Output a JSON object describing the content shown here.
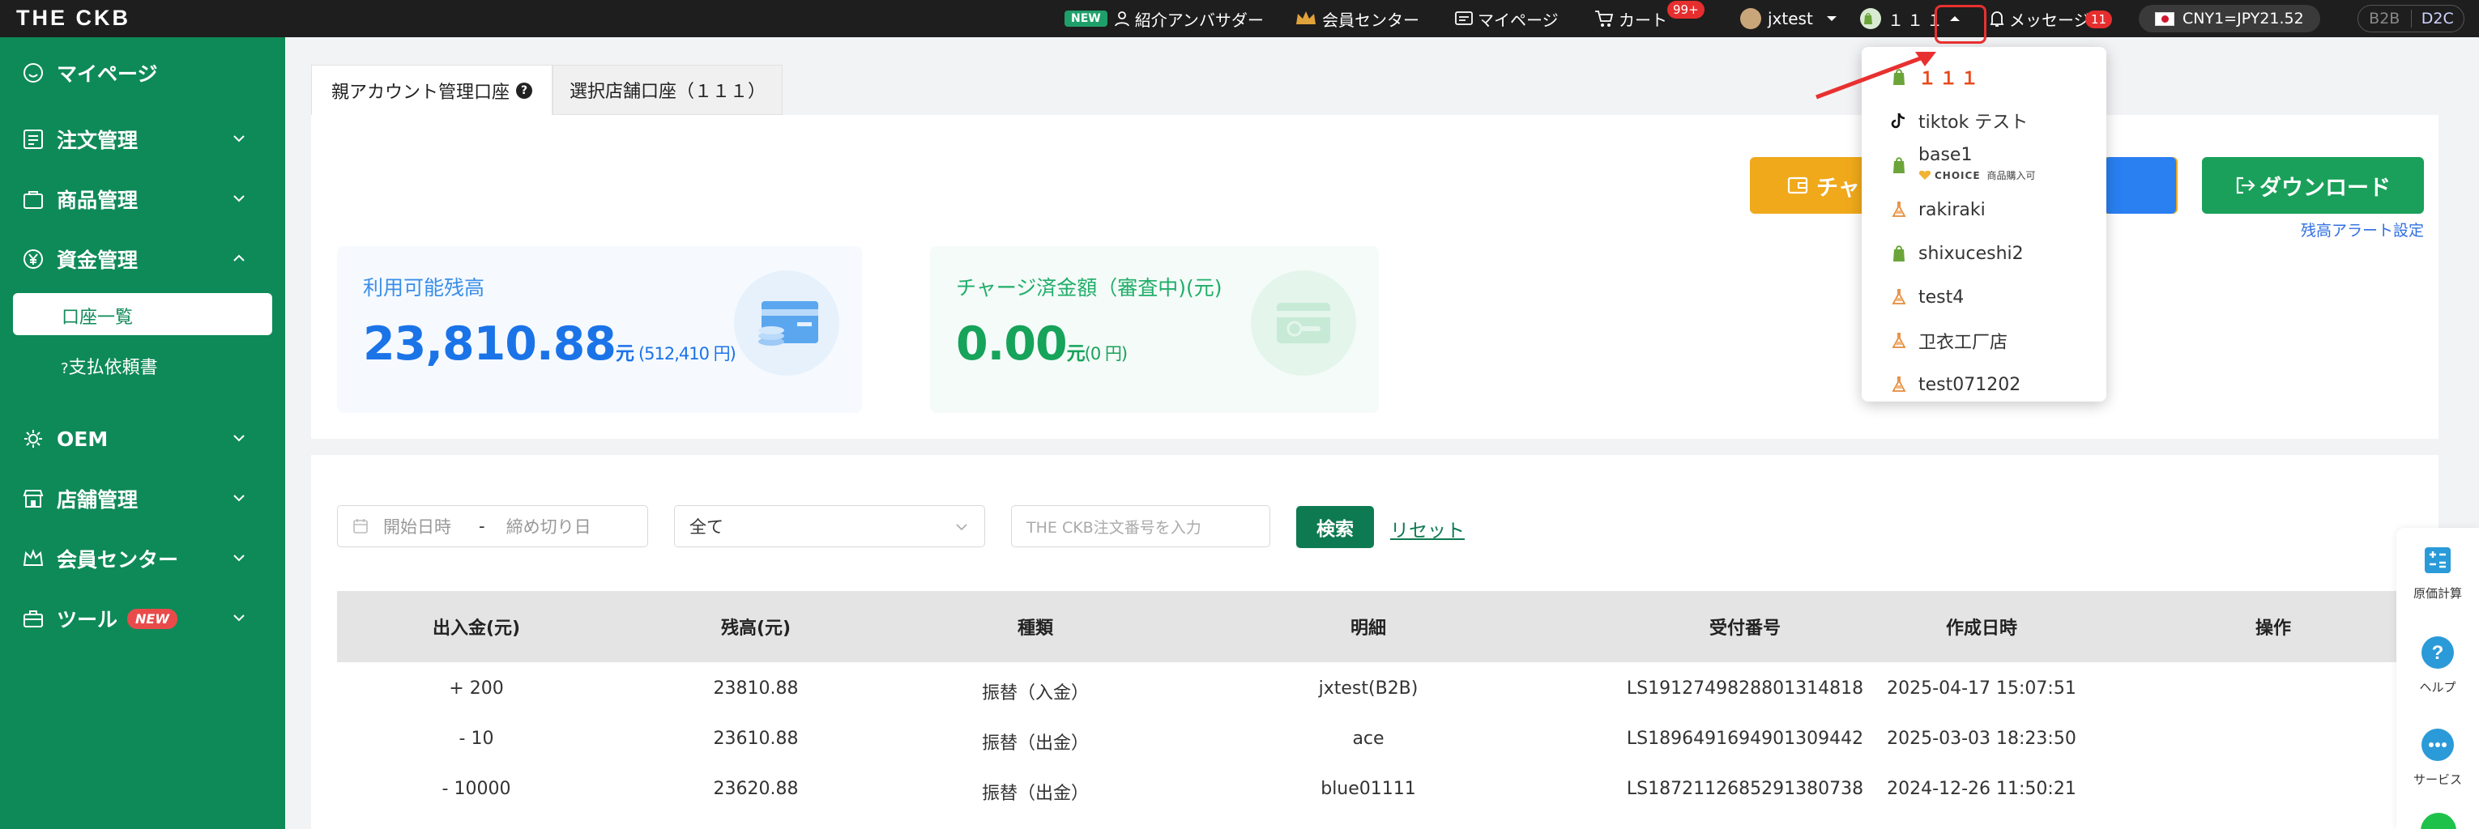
{
  "app": {
    "logo": "THE CKB"
  },
  "topbar": {
    "new_tag": "NEW",
    "ambassador": "紹介アンバサダー",
    "member_center": "会員センター",
    "mypage": "マイページ",
    "cart": "カート",
    "cart_badge": "99+",
    "user": "jxtest",
    "shop": "１１１",
    "messages": "メッセージ",
    "messages_badge": "11",
    "currency": "CNY1=JPY21.52",
    "mode_b2b": "B2B",
    "mode_d2c": "D2C"
  },
  "sidebar": {
    "mypage": "マイページ",
    "orders": "注文管理",
    "products": "商品管理",
    "funds": "資金管理",
    "account_list": "口座一覧",
    "payment_requests": "支払依頼書",
    "oem": "OEM",
    "stores": "店舗管理",
    "member_center": "会員センター",
    "tools": "ツール",
    "tools_new": "NEW"
  },
  "tabs": {
    "parent": "親アカウント管理口座",
    "selected": "選択店舗口座（１１１）"
  },
  "actions": {
    "charge": "チャー",
    "download": "ダウンロード",
    "alert_settings": "残高アラート設定"
  },
  "balances": {
    "available_label": "利用可能残高",
    "available_amount": "23,810.88",
    "available_unit": "元",
    "available_jpy": "(512,410 円)",
    "pending_label": "チャージ済金額（審査中)(元)",
    "pending_amount": "0.00",
    "pending_unit": "元",
    "pending_jpy": "(0 円)"
  },
  "filters": {
    "start_placeholder": "開始日時",
    "separator": "-",
    "end_placeholder": "締め切り日",
    "type_value": "全て",
    "order_placeholder": "THE CKB注文番号を入力",
    "search": "検索",
    "reset": "リセット"
  },
  "table": {
    "headers": [
      "出入金(元)",
      "残高(元)",
      "種類",
      "明細",
      "受付番号",
      "作成日時",
      "操作"
    ],
    "rows": [
      [
        "+ 200",
        "23810.88",
        "振替（入金）",
        "jxtest(B2B)",
        "LS1912749828801314818",
        "2025-04-17 15:07:51"
      ],
      [
        "- 10",
        "23610.88",
        "振替（出金）",
        "ace",
        "LS1896491694901309442",
        "2025-03-03 18:23:50"
      ],
      [
        "- 10000",
        "23620.88",
        "振替（出金）",
        "blue01111",
        "LS1872112685291380738",
        "2024-12-26 11:50:21"
      ]
    ]
  },
  "dropdown": {
    "items": [
      "１１１",
      "tiktok テスト",
      "base1",
      "rakiraki",
      "shixuceshi2",
      "test4",
      "卫衣工厂店",
      "test071202"
    ],
    "choice_brand": "CHOICE",
    "choice_text": "商品購入可"
  },
  "side_tools": {
    "cost_calc": "原価計算",
    "help": "ヘルプ",
    "service": "サービス"
  },
  "colors": {
    "sidebar_green": "#0e8a58",
    "blue_amount": "#1b73e8",
    "green_amount": "#16a35a",
    "charge_yellow": "#f0a91a",
    "download_green": "#1aa05a"
  }
}
